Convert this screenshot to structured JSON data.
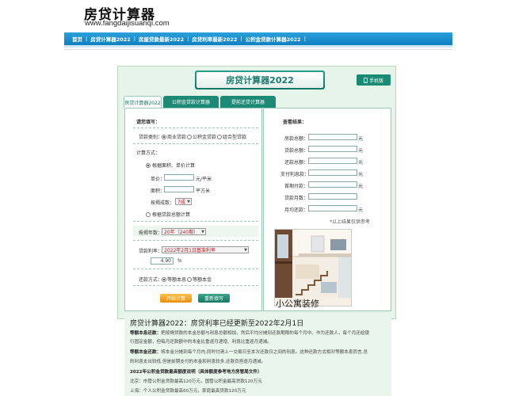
{
  "site": {
    "logo_title": "房贷计算器",
    "logo_url": "www.fangdaijisuanqi.com"
  },
  "nav": {
    "items": [
      "首页",
      "房贷计算器2022",
      "房屋贷款最新2022",
      "房贷利率最新2022",
      "公积金贷款计算器2022"
    ],
    "separator": "|"
  },
  "calc": {
    "title": "房贷计算器2022",
    "mobile_button": "手机版",
    "tabs": [
      "房贷计算器2022",
      "公积金贷款计算器",
      "提前还贷计算器"
    ],
    "form": {
      "section_title": "请您填写：",
      "loan_type_label": "贷款类别：",
      "loan_type_options": [
        "商业贷款",
        "公积金贷款",
        "组合型贷款"
      ],
      "calc_method_label": "计算方式：",
      "method_by_area": "根据面积、单价计算",
      "unit_price_label": "单价：",
      "unit_price_value": "",
      "unit_price_unit": "元/平米",
      "area_label": "面积：",
      "area_value": "",
      "area_unit": "平方米",
      "mortgage_ratio_label": "按揭成数：",
      "mortgage_ratio_value": "7成",
      "method_by_total": "根据贷款总额计算",
      "years_label": "按揭年数：",
      "years_value": "20年（240期）",
      "rate_label": "贷款利率：",
      "rate_value": "2022年2月1日基准利率",
      "rate_number": "4.90",
      "rate_unit": "%",
      "repay_label": "还款方式：",
      "repay_options": [
        "等额本息",
        "等额本金"
      ],
      "start_button": "开始计算",
      "reset_button": "重新填写"
    },
    "results": {
      "section_title": "查看结果：",
      "fields": [
        {
          "label": "房款总额：",
          "unit": "元"
        },
        {
          "label": "贷款总额：",
          "unit": "元"
        },
        {
          "label": "还款总额：",
          "unit": "元"
        },
        {
          "label": "支付利息款：",
          "unit": "元"
        },
        {
          "label": "首期付款：",
          "unit": "元"
        },
        {
          "label": "贷款月数：",
          "unit": ""
        },
        {
          "label": "月均还款：",
          "unit": "元"
        }
      ],
      "note": "*以上结果仅供参考"
    },
    "promo_caption": "小公寓装修"
  },
  "article": {
    "title": "房贷计算器2022：房贷利率已经更新至2022年2月1日",
    "lines": [
      {
        "head": "等额本息还款：",
        "text": "把按揭贷款的本金总额与利息总额相加，然后平均分摊到还款期限的每个月中。作为还款人，每个月还给银"
      },
      {
        "head": "",
        "text": "行固定金额，但每月还款额中的本金比重逐月递增、利息比重逐月递减。"
      },
      {
        "head": "等额本金还款：",
        "text": "将本金分摊到每个月内,同时付清上一交易日至本次还款日之间的利息。这种还款方式相对等额本息而言,总"
      },
      {
        "head": "",
        "text": "的利息支出较低,但是前期支付的本金和利息较多,还款负担逐月递减。"
      },
      {
        "head": "2022年公积金贷款最高额度说明（具体额度参考地方房管局文件）",
        "text": ""
      },
      {
        "head": "",
        "text": "北京：市管公积金贷款最高120万元，国管公积金最高贷款120万元"
      },
      {
        "head": "",
        "text": "上海：个人公积金贷款最高60万元，家庭最高贷款120万元"
      }
    ]
  },
  "colors": {
    "nav_blue": "#1a8fcc",
    "accent_green": "#1a8a74",
    "label_red": "#c4161c",
    "button_orange": "#ec8d0c"
  }
}
